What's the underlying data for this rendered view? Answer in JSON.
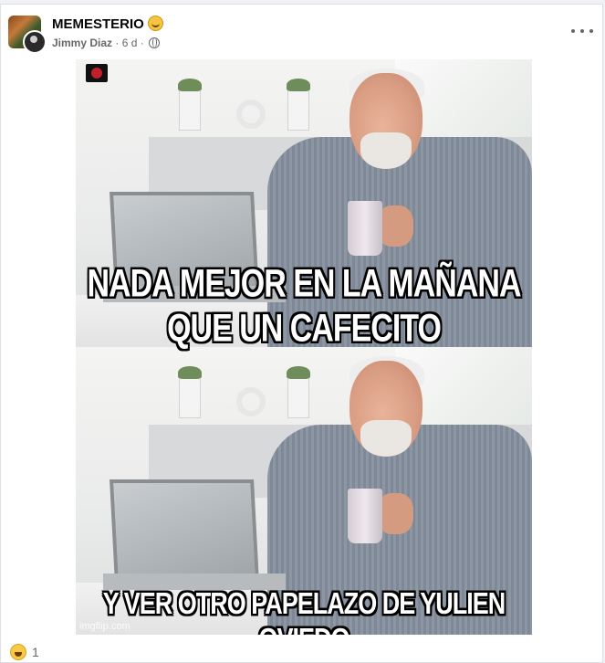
{
  "post": {
    "group_name": "MEMESTERIO",
    "author": "Jimmy Diaz",
    "time": "6 d",
    "separator": "·",
    "privacy_icon": "globe-icon",
    "more_icon": "more-options-icon"
  },
  "meme": {
    "caption_top": "NADA MEJOR EN LA MAÑANA QUE UN CAFECITO",
    "caption_bottom": "Y VER OTRO PAPELAZO DE YULIEN OVIEDO",
    "watermark": "imgflip.com"
  },
  "reactions": {
    "icon": "haha-reaction-icon",
    "count": "1"
  }
}
